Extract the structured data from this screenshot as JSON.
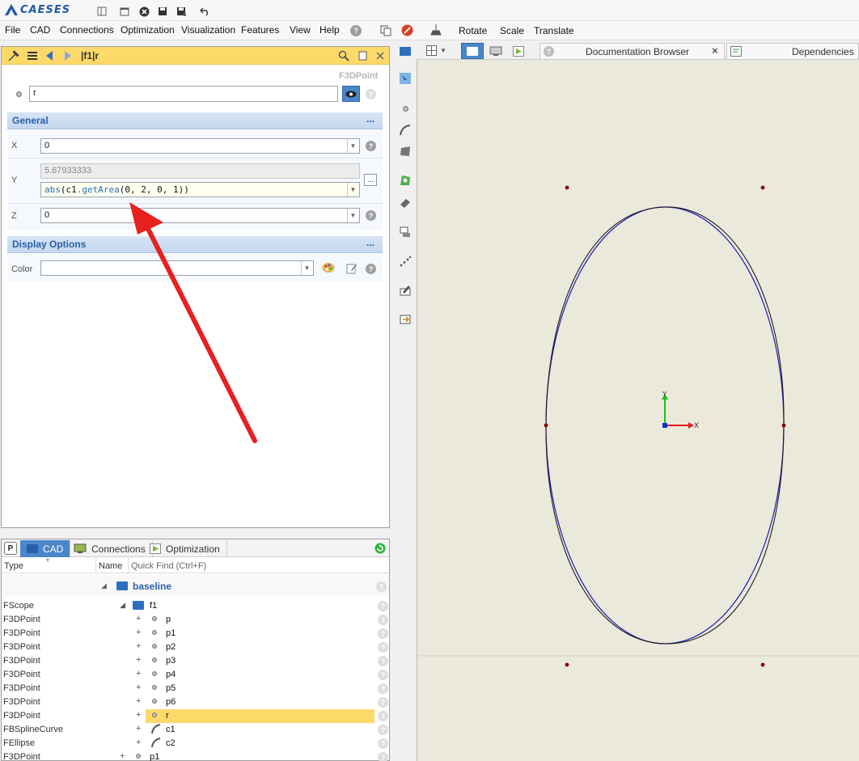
{
  "app": {
    "logo_text": "CAESES"
  },
  "menu": [
    "File",
    "CAD",
    "Connections",
    "Optimization",
    "Visualization",
    "Features",
    "View",
    "Help"
  ],
  "view_tools": {
    "rotate": "Rotate",
    "scale": "Scale",
    "translate": "Translate"
  },
  "object_editor": {
    "breadcrumb": "|f1|r",
    "type": "F3DPoint",
    "name_value": "r",
    "general_section": "General",
    "display_section": "Display Options",
    "more": "...",
    "x_label": "X",
    "x_value": "0",
    "y_label": "Y",
    "y_computed": "5.67933333",
    "y_expr_fn": "abs",
    "y_expr_obj": "c1",
    "y_expr_method": ".getArea",
    "y_expr_args": "(0, 2, 0, 1)",
    "y_expr_close": ")",
    "z_label": "Z",
    "z_value": "0",
    "color_label": "Color",
    "color_value": "",
    "ellipsis": "..."
  },
  "tree": {
    "tabs": [
      "CAD",
      "Connections",
      "Optimization"
    ],
    "col_type": "Type",
    "col_name": "Name",
    "quick_find_placeholder": "Quick Find (Ctrl+F)",
    "root": "baseline",
    "rows": [
      {
        "type": "FScope",
        "name": "f1",
        "kind": "folder",
        "expander": "◢",
        "selected": false
      },
      {
        "type": "F3DPoint",
        "name": "p",
        "kind": "point",
        "expander": "+",
        "selected": false
      },
      {
        "type": "F3DPoint",
        "name": "p1",
        "kind": "point",
        "expander": "+",
        "selected": false
      },
      {
        "type": "F3DPoint",
        "name": "p2",
        "kind": "point",
        "expander": "+",
        "selected": false
      },
      {
        "type": "F3DPoint",
        "name": "p3",
        "kind": "point",
        "expander": "+",
        "selected": false
      },
      {
        "type": "F3DPoint",
        "name": "p4",
        "kind": "point",
        "expander": "+",
        "selected": false
      },
      {
        "type": "F3DPoint",
        "name": "p5",
        "kind": "point",
        "expander": "+",
        "selected": false
      },
      {
        "type": "F3DPoint",
        "name": "p6",
        "kind": "point",
        "expander": "+",
        "selected": false
      },
      {
        "type": "F3DPoint",
        "name": "r",
        "kind": "point",
        "expander": "+",
        "selected": true
      },
      {
        "type": "FBSplineCurve",
        "name": "c1",
        "kind": "curve",
        "expander": "+",
        "selected": false
      },
      {
        "type": "FEllipse",
        "name": "c2",
        "kind": "curve",
        "expander": "+",
        "selected": false
      },
      {
        "type": "F3DPoint",
        "name": "p1",
        "kind": "point",
        "expander": "+",
        "selected": false
      }
    ]
  },
  "viewport_tabs": {
    "documentation": "Documentation Browser",
    "dependencies": "Dependencies"
  },
  "axes": {
    "x": "X",
    "y": "Y"
  },
  "colors": {
    "highlight": "#fdd96a",
    "section_title": "#2a5da8",
    "accent": "#4a86c9",
    "spline": "#1a1a1a",
    "ellipse": "#1c1cb0",
    "annotation_arrow": "#e82020"
  }
}
